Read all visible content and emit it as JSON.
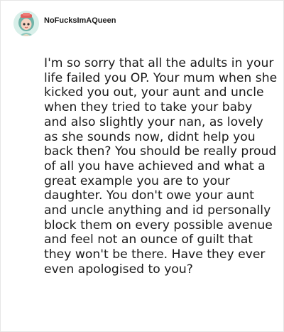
{
  "post": {
    "username": "NoFucksImAQueen",
    "avatar_icon": "cartoon-avatar-icon",
    "comment": "I'm so sorry that all the adults in your life failed you OP. Your mum when she kicked you out, your aunt and uncle when they tried to take your baby and also slightly your nan, as lovely as she sounds now, didnt help you back then? You should be really proud of all you have achieved and what a great example you are to your daughter. You don't owe your aunt and uncle anything and id personally block them on every possible avenue and feel not an ounce of guilt that they won't be there. Have they ever even apologised to you?"
  },
  "colors": {
    "text": "#1a1a1a",
    "border": "#e6e6e6",
    "avatar_bg": "#d8efe9"
  }
}
